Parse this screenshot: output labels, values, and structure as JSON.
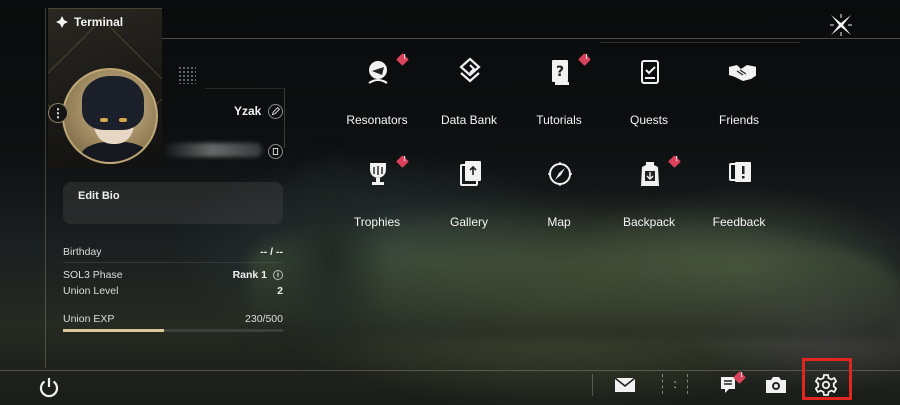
{
  "window": {
    "title": "Terminal"
  },
  "profile": {
    "name": "Yzak",
    "edit_bio_label": "Edit Bio"
  },
  "stats": [
    {
      "label": "Birthday",
      "value": "-- / --"
    },
    {
      "label": "SOL3 Phase",
      "value": "Rank 1"
    },
    {
      "label": "Union Level",
      "value": "2"
    }
  ],
  "exp": {
    "label": "Union EXP",
    "value": "230/500",
    "fraction": 0.46
  },
  "menu": [
    {
      "label": "Resonators",
      "icon": "resonators-icon",
      "badge": true
    },
    {
      "label": "Data Bank",
      "icon": "data-bank-icon",
      "badge": false
    },
    {
      "label": "Tutorials",
      "icon": "tutorials-icon",
      "badge": true
    },
    {
      "label": "Quests",
      "icon": "quests-icon",
      "badge": false
    },
    {
      "label": "Friends",
      "icon": "friends-icon",
      "badge": false
    },
    {
      "label": "Trophies",
      "icon": "trophies-icon",
      "badge": true
    },
    {
      "label": "Gallery",
      "icon": "gallery-icon",
      "badge": false
    },
    {
      "label": "Map",
      "icon": "map-icon",
      "badge": false
    },
    {
      "label": "Backpack",
      "icon": "backpack-icon",
      "badge": true
    },
    {
      "label": "Feedback",
      "icon": "feedback-icon",
      "badge": false
    }
  ],
  "bottom_bar": {
    "colon_label": ":",
    "icons": [
      "power-icon",
      "mail-icon",
      "notes-icon",
      "camera-icon",
      "settings-icon"
    ]
  },
  "colors": {
    "badge": "#d9425a",
    "highlight": "#e0271f",
    "accent": "#d9c79a"
  }
}
